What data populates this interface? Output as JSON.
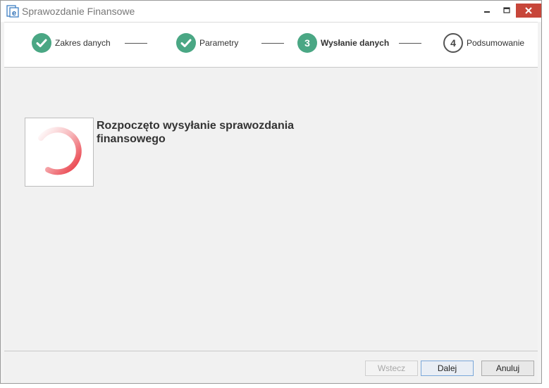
{
  "window": {
    "title": "Sprawozdanie Finansowe",
    "icon": "e-document-icon"
  },
  "stepper": {
    "steps": [
      {
        "number": "1",
        "label": "Zakres danych",
        "state": "done"
      },
      {
        "number": "2",
        "label": "Parametry",
        "state": "done"
      },
      {
        "number": "3",
        "label": "Wysłanie danych",
        "state": "active"
      },
      {
        "number": "4",
        "label": "Podsumowanie",
        "state": "pending"
      }
    ]
  },
  "main": {
    "message": "Rozpoczęto wysyłanie sprawozdania finansowego"
  },
  "footer": {
    "back_label": "Wstecz",
    "next_label": "Dalej",
    "cancel_label": "Anuluj"
  },
  "colors": {
    "step_done": "#4aa784",
    "close_button": "#c7463a",
    "spinner": "#e8323c"
  }
}
